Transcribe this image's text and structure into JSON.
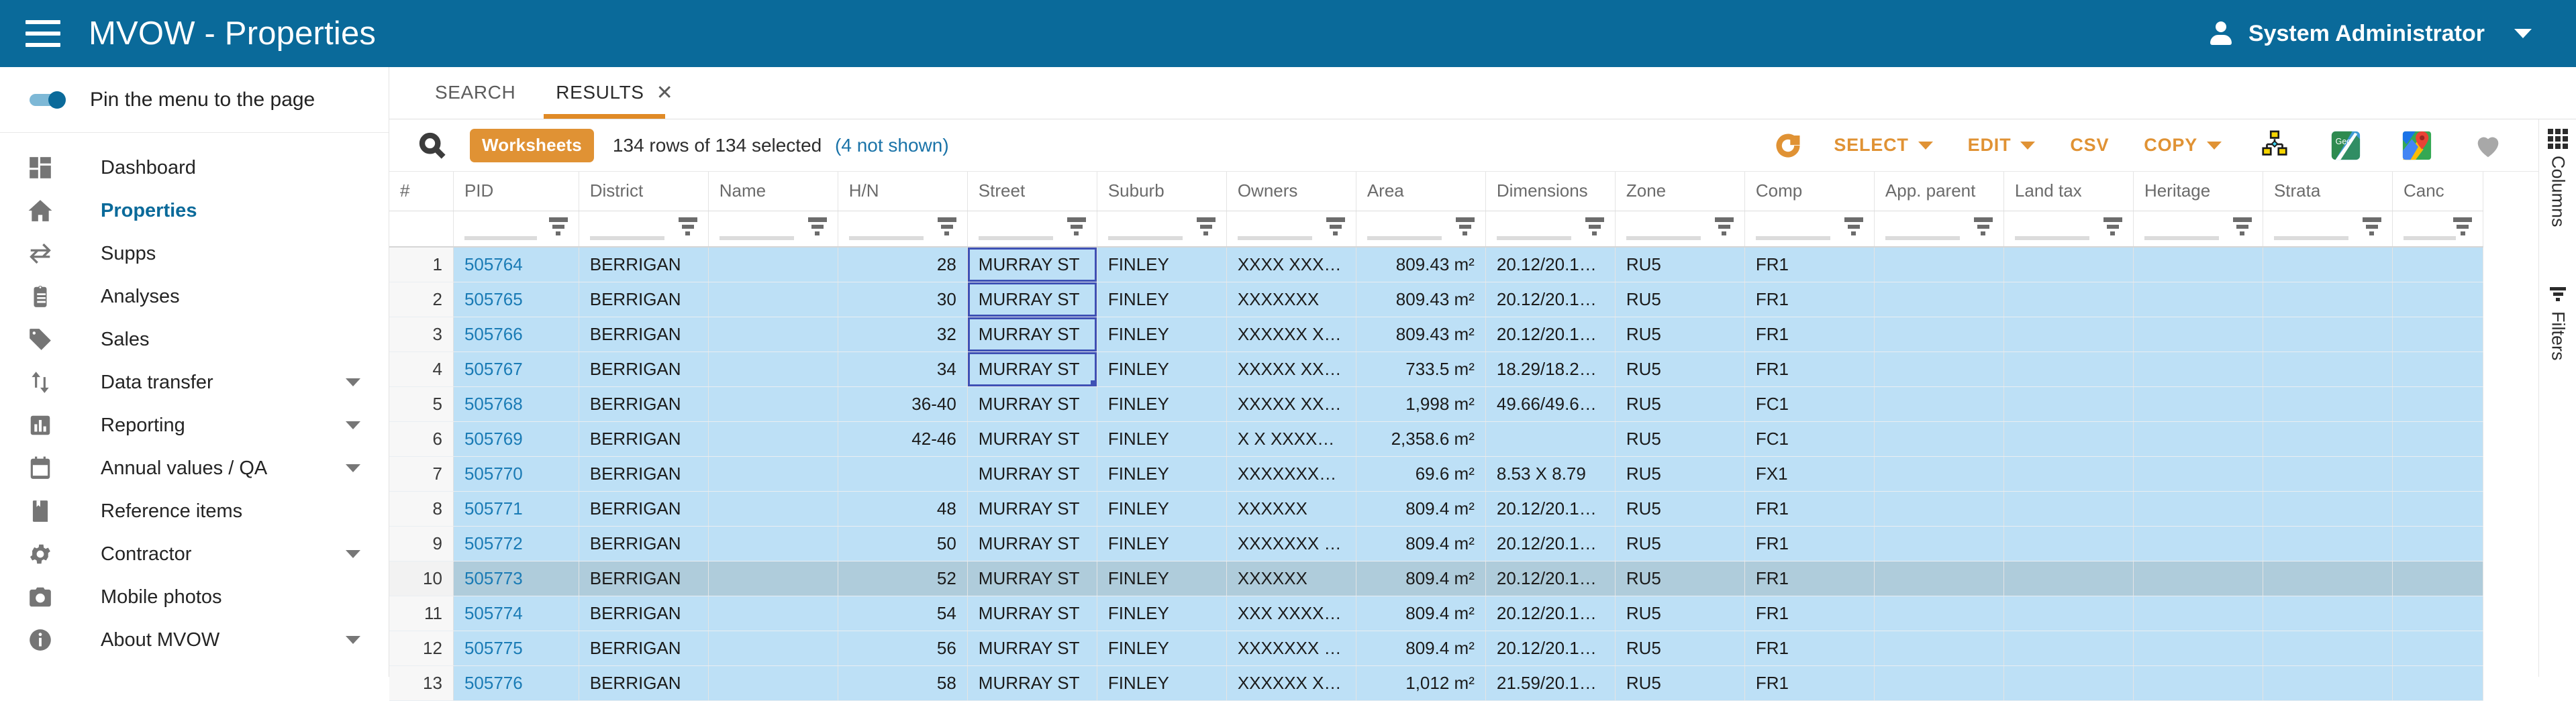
{
  "appbar": {
    "menu_icon": "hamburger-icon",
    "title": "MVOW - Properties",
    "user_icon": "person-icon",
    "user_name": "System Administrator",
    "caret_icon": "chevron-down-icon",
    "background": "#0a6a9a"
  },
  "sidebar": {
    "pin_label": "Pin the menu to the page",
    "pin_on": true,
    "items": [
      {
        "label": "Dashboard",
        "icon": "dashboard-icon",
        "active": false,
        "expandable": false
      },
      {
        "label": "Properties",
        "icon": "home-icon",
        "active": true,
        "expandable": false
      },
      {
        "label": "Supps",
        "icon": "transfer-icon",
        "active": false,
        "expandable": false
      },
      {
        "label": "Analyses",
        "icon": "clipboard-icon",
        "active": false,
        "expandable": false
      },
      {
        "label": "Sales",
        "icon": "tag-icon",
        "active": false,
        "expandable": false
      },
      {
        "label": "Data transfer",
        "icon": "updown-arrow-icon",
        "active": false,
        "expandable": true
      },
      {
        "label": "Reporting",
        "icon": "bar-chart-icon",
        "active": false,
        "expandable": true
      },
      {
        "label": "Annual values / QA",
        "icon": "calendar-icon",
        "active": false,
        "expandable": true
      },
      {
        "label": "Reference items",
        "icon": "bookmark-icon",
        "active": false,
        "expandable": false
      },
      {
        "label": "Contractor",
        "icon": "gear-icon",
        "active": false,
        "expandable": true
      },
      {
        "label": "Mobile photos",
        "icon": "camera-icon",
        "active": false,
        "expandable": false
      },
      {
        "label": "About MVOW",
        "icon": "info-icon",
        "active": false,
        "expandable": true
      }
    ]
  },
  "tabs": [
    {
      "label": "SEARCH",
      "active": false,
      "closable": false
    },
    {
      "label": "RESULTS",
      "active": true,
      "closable": true,
      "close_icon": "close-icon"
    }
  ],
  "toolbar": {
    "search_icon": "search-icon",
    "badge": "Worksheets",
    "row_info": "134 rows of 134 selected",
    "not_shown_link": "(4 not shown)",
    "refresh_icon": "refresh-icon",
    "buttons": [
      {
        "label": "SELECT",
        "dropdown": true
      },
      {
        "label": "EDIT",
        "dropdown": true
      },
      {
        "label": "CSV",
        "dropdown": false
      },
      {
        "label": "COPY",
        "dropdown": true
      }
    ],
    "icons": [
      "hierarchy-icon",
      "geo-icon",
      "google-maps-icon",
      "heart-icon",
      "more-vertical-icon"
    ],
    "accent_color": "#e09234"
  },
  "right_rail": {
    "columns_label": "Columns",
    "columns_icon": "grid-dots-icon",
    "filters_label": "Filters",
    "filters_icon": "filter-icon"
  },
  "table": {
    "columns": [
      {
        "key": "idx",
        "label": "#",
        "width": 92,
        "align": "right",
        "filter": false
      },
      {
        "key": "pid",
        "label": "PID",
        "width": 180,
        "align": "left",
        "filter": true
      },
      {
        "key": "district",
        "label": "District",
        "width": 186,
        "align": "left",
        "filter": true
      },
      {
        "key": "name",
        "label": "Name",
        "width": 186,
        "align": "left",
        "filter": true
      },
      {
        "key": "hn",
        "label": "H/N",
        "width": 186,
        "align": "right",
        "filter": true
      },
      {
        "key": "street",
        "label": "Street",
        "width": 186,
        "align": "left",
        "filter": true
      },
      {
        "key": "suburb",
        "label": "Suburb",
        "width": 186,
        "align": "left",
        "filter": true
      },
      {
        "key": "owners",
        "label": "Owners",
        "width": 186,
        "align": "left",
        "filter": true
      },
      {
        "key": "area",
        "label": "Area",
        "width": 186,
        "align": "right",
        "filter": true
      },
      {
        "key": "dimensions",
        "label": "Dimensions",
        "width": 186,
        "align": "left",
        "filter": true
      },
      {
        "key": "zone",
        "label": "Zone",
        "width": 186,
        "align": "left",
        "filter": true
      },
      {
        "key": "comp",
        "label": "Comp",
        "width": 186,
        "align": "left",
        "filter": true
      },
      {
        "key": "appparent",
        "label": "App. parent",
        "width": 186,
        "align": "left",
        "filter": true
      },
      {
        "key": "landtax",
        "label": "Land tax",
        "width": 186,
        "align": "left",
        "filter": true
      },
      {
        "key": "heritage",
        "label": "Heritage",
        "width": 186,
        "align": "left",
        "filter": true
      },
      {
        "key": "strata",
        "label": "Strata",
        "width": 186,
        "align": "left",
        "filter": true
      },
      {
        "key": "canc",
        "label": "Canc",
        "width": 130,
        "align": "left",
        "filter": true
      }
    ],
    "selection": {
      "column": "street",
      "rows": [
        1,
        2,
        3,
        4
      ]
    },
    "hover_row": 10,
    "rows": [
      {
        "idx": "1",
        "pid": "505764",
        "district": "BERRIGAN",
        "name": "",
        "hn": "28",
        "street": "MURRAY ST",
        "suburb": "FINLEY",
        "owners": "XXXX XXX…",
        "area": "809.43 m²",
        "dimensions": "20.12/20.1…",
        "zone": "RU5",
        "comp": "FR1",
        "appparent": "",
        "landtax": "",
        "heritage": "",
        "strata": "",
        "canc": ""
      },
      {
        "idx": "2",
        "pid": "505765",
        "district": "BERRIGAN",
        "name": "",
        "hn": "30",
        "street": "MURRAY ST",
        "suburb": "FINLEY",
        "owners": "XXXXXXX",
        "area": "809.43 m²",
        "dimensions": "20.12/20.1…",
        "zone": "RU5",
        "comp": "FR1",
        "appparent": "",
        "landtax": "",
        "heritage": "",
        "strata": "",
        "canc": ""
      },
      {
        "idx": "3",
        "pid": "505766",
        "district": "BERRIGAN",
        "name": "",
        "hn": "32",
        "street": "MURRAY ST",
        "suburb": "FINLEY",
        "owners": "XXXXXX X…",
        "area": "809.43 m²",
        "dimensions": "20.12/20.1…",
        "zone": "RU5",
        "comp": "FR1",
        "appparent": "",
        "landtax": "",
        "heritage": "",
        "strata": "",
        "canc": ""
      },
      {
        "idx": "4",
        "pid": "505767",
        "district": "BERRIGAN",
        "name": "",
        "hn": "34",
        "street": "MURRAY ST",
        "suburb": "FINLEY",
        "owners": "XXXXX XX…",
        "area": "733.5 m²",
        "dimensions": "18.29/18.2…",
        "zone": "RU5",
        "comp": "FR1",
        "appparent": "",
        "landtax": "",
        "heritage": "",
        "strata": "",
        "canc": ""
      },
      {
        "idx": "5",
        "pid": "505768",
        "district": "BERRIGAN",
        "name": "",
        "hn": "36-40",
        "street": "MURRAY ST",
        "suburb": "FINLEY",
        "owners": "XXXXX XX…",
        "area": "1,998 m²",
        "dimensions": "49.66/49.6…",
        "zone": "RU5",
        "comp": "FC1",
        "appparent": "",
        "landtax": "",
        "heritage": "",
        "strata": "",
        "canc": ""
      },
      {
        "idx": "6",
        "pid": "505769",
        "district": "BERRIGAN",
        "name": "",
        "hn": "42-46",
        "street": "MURRAY ST",
        "suburb": "FINLEY",
        "owners": "X X XXXXX…",
        "area": "2,358.6 m²",
        "dimensions": "",
        "zone": "RU5",
        "comp": "FC1",
        "appparent": "",
        "landtax": "",
        "heritage": "",
        "strata": "",
        "canc": ""
      },
      {
        "idx": "7",
        "pid": "505770",
        "district": "BERRIGAN",
        "name": "",
        "hn": "",
        "street": "MURRAY ST",
        "suburb": "FINLEY",
        "owners": "XXXXXXXX…",
        "area": "69.6 m²",
        "dimensions": "8.53 X 8.79",
        "zone": "RU5",
        "comp": "FX1",
        "appparent": "",
        "landtax": "",
        "heritage": "",
        "strata": "",
        "canc": ""
      },
      {
        "idx": "8",
        "pid": "505771",
        "district": "BERRIGAN",
        "name": "",
        "hn": "48",
        "street": "MURRAY ST",
        "suburb": "FINLEY",
        "owners": "XXXXXX",
        "area": "809.4 m²",
        "dimensions": "20.12/20.1…",
        "zone": "RU5",
        "comp": "FR1",
        "appparent": "",
        "landtax": "",
        "heritage": "",
        "strata": "",
        "canc": ""
      },
      {
        "idx": "9",
        "pid": "505772",
        "district": "BERRIGAN",
        "name": "",
        "hn": "50",
        "street": "MURRAY ST",
        "suburb": "FINLEY",
        "owners": "XXXXXXX …",
        "area": "809.4 m²",
        "dimensions": "20.12/20.1…",
        "zone": "RU5",
        "comp": "FR1",
        "appparent": "",
        "landtax": "",
        "heritage": "",
        "strata": "",
        "canc": ""
      },
      {
        "idx": "10",
        "pid": "505773",
        "district": "BERRIGAN",
        "name": "",
        "hn": "52",
        "street": "MURRAY ST",
        "suburb": "FINLEY",
        "owners": "XXXXXX",
        "area": "809.4 m²",
        "dimensions": "20.12/20.1…",
        "zone": "RU5",
        "comp": "FR1",
        "appparent": "",
        "landtax": "",
        "heritage": "",
        "strata": "",
        "canc": ""
      },
      {
        "idx": "11",
        "pid": "505774",
        "district": "BERRIGAN",
        "name": "",
        "hn": "54",
        "street": "MURRAY ST",
        "suburb": "FINLEY",
        "owners": "XXX XXXX…",
        "area": "809.4 m²",
        "dimensions": "20.12/20.1…",
        "zone": "RU5",
        "comp": "FR1",
        "appparent": "",
        "landtax": "",
        "heritage": "",
        "strata": "",
        "canc": ""
      },
      {
        "idx": "12",
        "pid": "505775",
        "district": "BERRIGAN",
        "name": "",
        "hn": "56",
        "street": "MURRAY ST",
        "suburb": "FINLEY",
        "owners": "XXXXXXX …",
        "area": "809.4 m²",
        "dimensions": "20.12/20.1…",
        "zone": "RU5",
        "comp": "FR1",
        "appparent": "",
        "landtax": "",
        "heritage": "",
        "strata": "",
        "canc": ""
      },
      {
        "idx": "13",
        "pid": "505776",
        "district": "BERRIGAN",
        "name": "",
        "hn": "58",
        "street": "MURRAY ST",
        "suburb": "FINLEY",
        "owners": "XXXXXX X…",
        "area": "1,012 m²",
        "dimensions": "21.59/20.1…",
        "zone": "RU5",
        "comp": "FR1",
        "appparent": "",
        "landtax": "",
        "heritage": "",
        "strata": "",
        "canc": ""
      }
    ]
  }
}
